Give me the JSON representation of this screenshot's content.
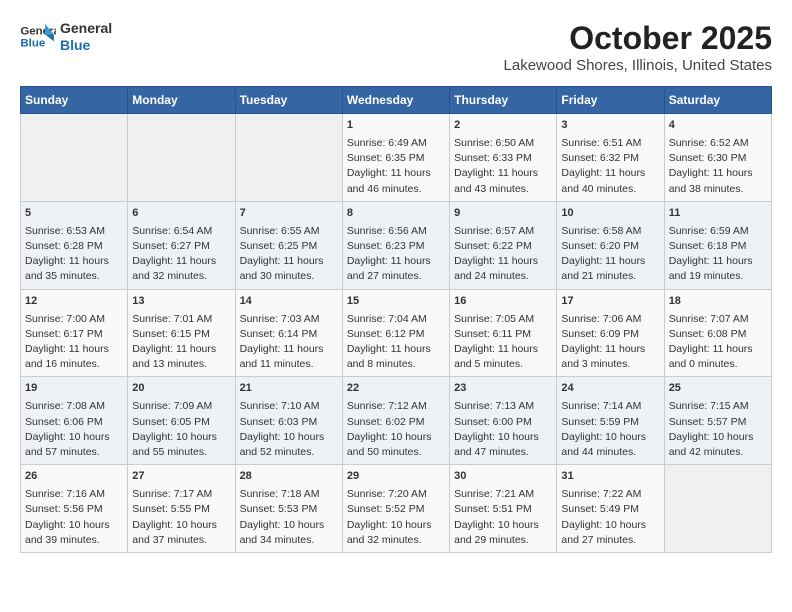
{
  "header": {
    "logo_line1": "General",
    "logo_line2": "Blue",
    "month": "October 2025",
    "location": "Lakewood Shores, Illinois, United States"
  },
  "weekdays": [
    "Sunday",
    "Monday",
    "Tuesday",
    "Wednesday",
    "Thursday",
    "Friday",
    "Saturday"
  ],
  "weeks": [
    [
      {
        "day": "",
        "sunrise": "",
        "sunset": "",
        "daylight": ""
      },
      {
        "day": "",
        "sunrise": "",
        "sunset": "",
        "daylight": ""
      },
      {
        "day": "",
        "sunrise": "",
        "sunset": "",
        "daylight": ""
      },
      {
        "day": "1",
        "sunrise": "Sunrise: 6:49 AM",
        "sunset": "Sunset: 6:35 PM",
        "daylight": "Daylight: 11 hours and 46 minutes."
      },
      {
        "day": "2",
        "sunrise": "Sunrise: 6:50 AM",
        "sunset": "Sunset: 6:33 PM",
        "daylight": "Daylight: 11 hours and 43 minutes."
      },
      {
        "day": "3",
        "sunrise": "Sunrise: 6:51 AM",
        "sunset": "Sunset: 6:32 PM",
        "daylight": "Daylight: 11 hours and 40 minutes."
      },
      {
        "day": "4",
        "sunrise": "Sunrise: 6:52 AM",
        "sunset": "Sunset: 6:30 PM",
        "daylight": "Daylight: 11 hours and 38 minutes."
      }
    ],
    [
      {
        "day": "5",
        "sunrise": "Sunrise: 6:53 AM",
        "sunset": "Sunset: 6:28 PM",
        "daylight": "Daylight: 11 hours and 35 minutes."
      },
      {
        "day": "6",
        "sunrise": "Sunrise: 6:54 AM",
        "sunset": "Sunset: 6:27 PM",
        "daylight": "Daylight: 11 hours and 32 minutes."
      },
      {
        "day": "7",
        "sunrise": "Sunrise: 6:55 AM",
        "sunset": "Sunset: 6:25 PM",
        "daylight": "Daylight: 11 hours and 30 minutes."
      },
      {
        "day": "8",
        "sunrise": "Sunrise: 6:56 AM",
        "sunset": "Sunset: 6:23 PM",
        "daylight": "Daylight: 11 hours and 27 minutes."
      },
      {
        "day": "9",
        "sunrise": "Sunrise: 6:57 AM",
        "sunset": "Sunset: 6:22 PM",
        "daylight": "Daylight: 11 hours and 24 minutes."
      },
      {
        "day": "10",
        "sunrise": "Sunrise: 6:58 AM",
        "sunset": "Sunset: 6:20 PM",
        "daylight": "Daylight: 11 hours and 21 minutes."
      },
      {
        "day": "11",
        "sunrise": "Sunrise: 6:59 AM",
        "sunset": "Sunset: 6:18 PM",
        "daylight": "Daylight: 11 hours and 19 minutes."
      }
    ],
    [
      {
        "day": "12",
        "sunrise": "Sunrise: 7:00 AM",
        "sunset": "Sunset: 6:17 PM",
        "daylight": "Daylight: 11 hours and 16 minutes."
      },
      {
        "day": "13",
        "sunrise": "Sunrise: 7:01 AM",
        "sunset": "Sunset: 6:15 PM",
        "daylight": "Daylight: 11 hours and 13 minutes."
      },
      {
        "day": "14",
        "sunrise": "Sunrise: 7:03 AM",
        "sunset": "Sunset: 6:14 PM",
        "daylight": "Daylight: 11 hours and 11 minutes."
      },
      {
        "day": "15",
        "sunrise": "Sunrise: 7:04 AM",
        "sunset": "Sunset: 6:12 PM",
        "daylight": "Daylight: 11 hours and 8 minutes."
      },
      {
        "day": "16",
        "sunrise": "Sunrise: 7:05 AM",
        "sunset": "Sunset: 6:11 PM",
        "daylight": "Daylight: 11 hours and 5 minutes."
      },
      {
        "day": "17",
        "sunrise": "Sunrise: 7:06 AM",
        "sunset": "Sunset: 6:09 PM",
        "daylight": "Daylight: 11 hours and 3 minutes."
      },
      {
        "day": "18",
        "sunrise": "Sunrise: 7:07 AM",
        "sunset": "Sunset: 6:08 PM",
        "daylight": "Daylight: 11 hours and 0 minutes."
      }
    ],
    [
      {
        "day": "19",
        "sunrise": "Sunrise: 7:08 AM",
        "sunset": "Sunset: 6:06 PM",
        "daylight": "Daylight: 10 hours and 57 minutes."
      },
      {
        "day": "20",
        "sunrise": "Sunrise: 7:09 AM",
        "sunset": "Sunset: 6:05 PM",
        "daylight": "Daylight: 10 hours and 55 minutes."
      },
      {
        "day": "21",
        "sunrise": "Sunrise: 7:10 AM",
        "sunset": "Sunset: 6:03 PM",
        "daylight": "Daylight: 10 hours and 52 minutes."
      },
      {
        "day": "22",
        "sunrise": "Sunrise: 7:12 AM",
        "sunset": "Sunset: 6:02 PM",
        "daylight": "Daylight: 10 hours and 50 minutes."
      },
      {
        "day": "23",
        "sunrise": "Sunrise: 7:13 AM",
        "sunset": "Sunset: 6:00 PM",
        "daylight": "Daylight: 10 hours and 47 minutes."
      },
      {
        "day": "24",
        "sunrise": "Sunrise: 7:14 AM",
        "sunset": "Sunset: 5:59 PM",
        "daylight": "Daylight: 10 hours and 44 minutes."
      },
      {
        "day": "25",
        "sunrise": "Sunrise: 7:15 AM",
        "sunset": "Sunset: 5:57 PM",
        "daylight": "Daylight: 10 hours and 42 minutes."
      }
    ],
    [
      {
        "day": "26",
        "sunrise": "Sunrise: 7:16 AM",
        "sunset": "Sunset: 5:56 PM",
        "daylight": "Daylight: 10 hours and 39 minutes."
      },
      {
        "day": "27",
        "sunrise": "Sunrise: 7:17 AM",
        "sunset": "Sunset: 5:55 PM",
        "daylight": "Daylight: 10 hours and 37 minutes."
      },
      {
        "day": "28",
        "sunrise": "Sunrise: 7:18 AM",
        "sunset": "Sunset: 5:53 PM",
        "daylight": "Daylight: 10 hours and 34 minutes."
      },
      {
        "day": "29",
        "sunrise": "Sunrise: 7:20 AM",
        "sunset": "Sunset: 5:52 PM",
        "daylight": "Daylight: 10 hours and 32 minutes."
      },
      {
        "day": "30",
        "sunrise": "Sunrise: 7:21 AM",
        "sunset": "Sunset: 5:51 PM",
        "daylight": "Daylight: 10 hours and 29 minutes."
      },
      {
        "day": "31",
        "sunrise": "Sunrise: 7:22 AM",
        "sunset": "Sunset: 5:49 PM",
        "daylight": "Daylight: 10 hours and 27 minutes."
      },
      {
        "day": "",
        "sunrise": "",
        "sunset": "",
        "daylight": ""
      }
    ]
  ]
}
